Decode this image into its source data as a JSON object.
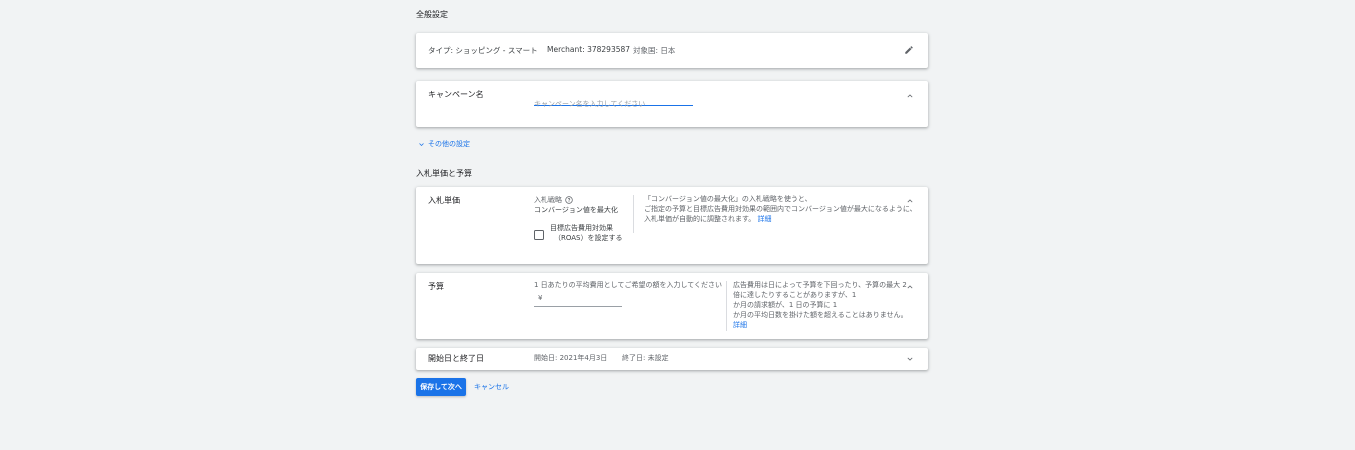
{
  "general": {
    "heading": "全般設定",
    "summary": {
      "type": "タイプ: ショッピング - スマート",
      "merchant": "Merchant: 378293587",
      "country": "対象国: 日本"
    },
    "edit_icon": "pencil-icon"
  },
  "campaign_name": {
    "label": "キャンペーン名",
    "placeholder": "キャンペーン名を入力してください",
    "value": ""
  },
  "more_settings": {
    "label": "その他の設定"
  },
  "bidding_section": {
    "heading": "入札単価と予算",
    "bidding": {
      "label": "入札単価",
      "strategy_label": "入札戦略",
      "strategy_value": "コンバージョン値を最大化",
      "checkbox_line1": "目標広告費用対効果",
      "checkbox_line2": "（ROAS）を設定する",
      "checkbox_checked": false,
      "info_line1": "「コンバージョン値の最大化」の入札戦略を使うと、",
      "info_line2": "ご指定の予算と目標広告費用対効果の範囲内でコンバージョン値が最大になるように、",
      "info_line3": "入札単価が自動的に調整されます。",
      "info_link": "詳細"
    },
    "budget": {
      "label": "予算",
      "prompt": "1 日あたりの平均費用としてご希望の額を入力してください",
      "currency": "¥",
      "value": "",
      "info_line1": "広告費用は日によって予算を下回ったり、予算の最大 2",
      "info_line2": "倍に達したりすることがありますが、1",
      "info_line3": "か月の請求額が、1 日の予算に 1",
      "info_line4": "か月の平均日数を掛けた額を超えることはありません。",
      "info_link": "詳細"
    },
    "dates": {
      "label": "開始日と終了日",
      "start": "開始日: 2021年4月3日",
      "end": "終了日: 未設定"
    }
  },
  "actions": {
    "save": "保存して次へ",
    "cancel": "キャンセル"
  },
  "colors": {
    "accent": "#1a73e8",
    "background": "#f1f3f4"
  }
}
